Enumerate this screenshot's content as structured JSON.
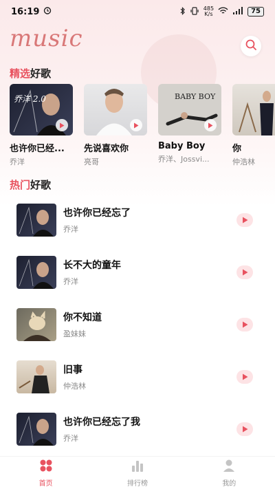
{
  "status": {
    "time": "16:19",
    "speed_top": "485",
    "speed_bottom": "K/s",
    "battery": "75"
  },
  "header": {
    "logo": "music"
  },
  "sections": {
    "featured": {
      "accent": "精选",
      "rest": "好歌"
    },
    "hot": {
      "accent": "热门",
      "rest": "好歌"
    }
  },
  "featured": [
    {
      "title": "也许你已经...",
      "artist": "乔洋",
      "cover_text": "乔洋 2.0"
    },
    {
      "title": "先说喜欢你",
      "artist": "亮哥",
      "cover_text": ""
    },
    {
      "title": "Baby Boy",
      "artist": "乔洋、Jossvi...",
      "cover_text": "BABY BOY"
    },
    {
      "title": "你",
      "artist": "仲浩林",
      "cover_text": ""
    }
  ],
  "hot": [
    {
      "title": "也许你已经忘了",
      "artist": "乔洋"
    },
    {
      "title": "长不大的童年",
      "artist": "乔洋"
    },
    {
      "title": "你不知道",
      "artist": "盈妹妹"
    },
    {
      "title": "旧事",
      "artist": "仲浩林"
    },
    {
      "title": "也许你已经忘了我",
      "artist": "乔洋"
    }
  ],
  "tabs": [
    {
      "label": "首页",
      "icon": "home-grid-icon"
    },
    {
      "label": "排行榜",
      "icon": "chart-bars-icon"
    },
    {
      "label": "我的",
      "icon": "profile-icon"
    }
  ],
  "colors": {
    "accent": "#e8525f",
    "logo": "#d97878",
    "play_bg": "#fde3e5"
  }
}
